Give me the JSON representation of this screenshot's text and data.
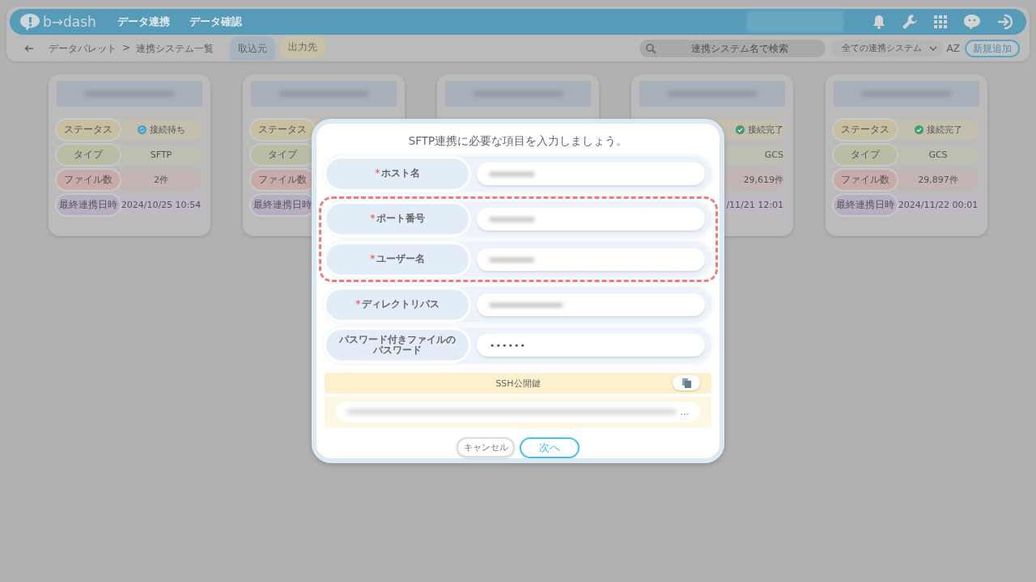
{
  "header": {
    "logo": "b→dash",
    "nav": [
      {
        "label": "データ連携"
      },
      {
        "label": "データ確認"
      }
    ]
  },
  "subnav": {
    "breadcrumb": [
      "データパレット",
      "連携システム一覧"
    ],
    "separator": ">",
    "tabs": [
      {
        "label": "取込元",
        "selected": true
      },
      {
        "label": "出力先",
        "selected": false
      }
    ],
    "search": {
      "placeholder": "連携システム名で検索"
    },
    "filter": {
      "value": "全ての連携システム"
    },
    "sort_label": "AZ",
    "add_button": "新規追加"
  },
  "cards": [
    {
      "title_redacted": true,
      "rows": [
        {
          "kind": "status",
          "label": "ステータス",
          "value": "接続待ち",
          "connected": false
        },
        {
          "kind": "type",
          "label": "タイプ",
          "value": "SFTP"
        },
        {
          "kind": "files",
          "label": "ファイル数",
          "value": "2件"
        },
        {
          "kind": "date",
          "label": "最終連携日時",
          "value": "2024/10/25 10:54"
        }
      ]
    },
    {
      "title_redacted": true,
      "rows": [
        {
          "kind": "status",
          "label": "ステータス"
        },
        {
          "kind": "type",
          "label": "タイプ"
        },
        {
          "kind": "files",
          "label": "ファイル数"
        },
        {
          "kind": "date",
          "label": "最終連携日時"
        }
      ]
    },
    {
      "title_redacted": true
    },
    {
      "title_redacted": true,
      "rows": [
        {
          "kind": "status",
          "value": "接続完了",
          "connected": true
        },
        {
          "kind": "type",
          "value": "GCS"
        },
        {
          "kind": "files",
          "value": "29,619件"
        },
        {
          "kind": "date",
          "value": "/11/21 12:01"
        }
      ]
    },
    {
      "title_redacted": true,
      "rows": [
        {
          "kind": "status",
          "label": "ステータス",
          "value": "接続完了",
          "connected": true
        },
        {
          "kind": "type",
          "label": "タイプ",
          "value": "GCS"
        },
        {
          "kind": "files",
          "label": "ファイル数",
          "value": "29,897件"
        },
        {
          "kind": "date",
          "label": "最終連携日時",
          "value": "2024/11/22 00:01"
        }
      ]
    }
  ],
  "modal": {
    "title": "SFTP連携に必要な項目を入力しましょう。",
    "required_mark": "*",
    "field_groups": [
      {
        "highlighted": false,
        "fields": [
          {
            "label": "ホスト名",
            "required": true,
            "redacted": true
          }
        ]
      },
      {
        "highlighted": true,
        "fields": [
          {
            "label": "ポート番号",
            "required": true,
            "redacted": true
          },
          {
            "label": "ユーザー名",
            "required": true,
            "redacted": true
          }
        ]
      },
      {
        "highlighted": false,
        "fields": [
          {
            "label": "ディレクトリパス",
            "required": true,
            "redacted": true
          },
          {
            "label": "パスワード付きファイルのパスワード",
            "required": false,
            "redacted": false,
            "value": "••••••"
          }
        ]
      }
    ],
    "ssh": {
      "title": "SSH公開鍵",
      "value_suffix": "..."
    },
    "cancel_button": "キャンセル",
    "next_button": "次へ"
  }
}
